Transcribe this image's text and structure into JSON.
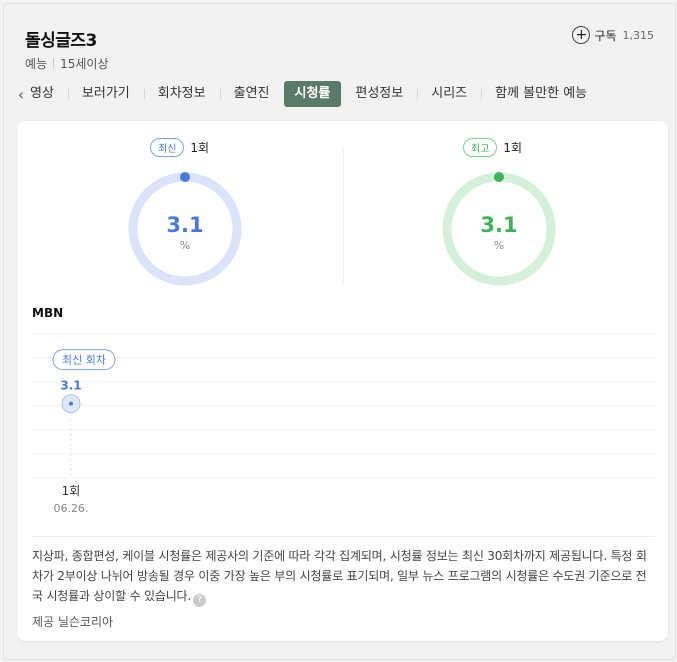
{
  "program": {
    "title": "돌싱글즈3",
    "genre": "예능",
    "rating": "15세이상"
  },
  "subscribe": {
    "label": "구독",
    "count": "1,315"
  },
  "tabs": [
    "영상",
    "보러가기",
    "회차정보",
    "출연진",
    "시청률",
    "편성정보",
    "시리즈",
    "함께 볼만한 예능"
  ],
  "active_tab": "시청률",
  "latest": {
    "badge": "최신",
    "episode": "1회",
    "value": "3.1",
    "unit": "%",
    "color": "#4a7adf",
    "ring_color": "#d9e4fa"
  },
  "best": {
    "badge": "최고",
    "episode": "1회",
    "value": "3.1",
    "unit": "%",
    "color": "#3db35a",
    "ring_color": "#d5f0d8"
  },
  "broadcaster": "MBN",
  "chart_data": {
    "type": "scatter",
    "marker_label": "최신 회차",
    "points": [
      {
        "episode": "1회",
        "date": "06.26.",
        "value": 3.1,
        "label": "3.1"
      }
    ]
  },
  "note": "지상파, 종합편성, 케이블 시청률은 제공사의 기준에 따라 각각 집계되며, 시청률 정보는 최신 30회차까지 제공됩니다. 특정 회차가 2부이상 나뉘어 방송될 경우 이중 가장 높은 부의 시청률로 표기되며, 일부 뉴스 프로그램의 시청률은 수도권 기준으로 전국 시청률과 상이할 수 있습니다.",
  "provider": "제공 닐슨코리아"
}
